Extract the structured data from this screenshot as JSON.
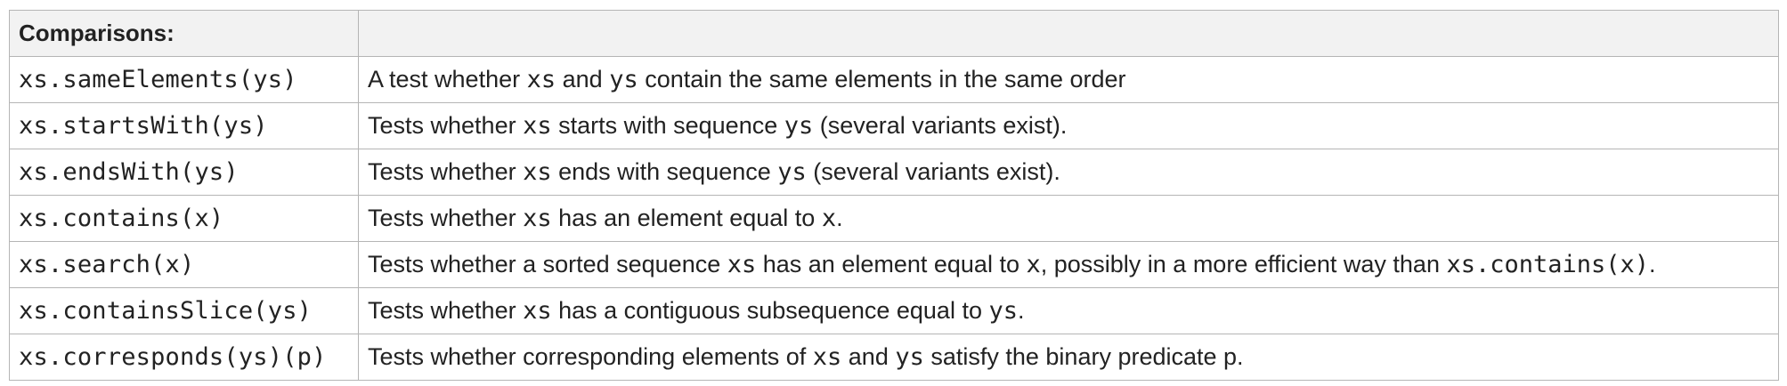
{
  "table": {
    "header": "Comparisons:",
    "rows": [
      {
        "op": "xs.sameElements(ys)",
        "desc": [
          {
            "t": "A test whether "
          },
          {
            "c": "xs"
          },
          {
            "t": " and "
          },
          {
            "c": "ys"
          },
          {
            "t": " contain the same elements in the same order"
          }
        ]
      },
      {
        "op": "xs.startsWith(ys)",
        "desc": [
          {
            "t": "Tests whether "
          },
          {
            "c": "xs"
          },
          {
            "t": " starts with sequence "
          },
          {
            "c": "ys"
          },
          {
            "t": " (several variants exist)."
          }
        ]
      },
      {
        "op": "xs.endsWith(ys)",
        "desc": [
          {
            "t": "Tests whether "
          },
          {
            "c": "xs"
          },
          {
            "t": " ends with sequence "
          },
          {
            "c": "ys"
          },
          {
            "t": " (several variants exist)."
          }
        ]
      },
      {
        "op": "xs.contains(x)",
        "desc": [
          {
            "t": "Tests whether "
          },
          {
            "c": "xs"
          },
          {
            "t": " has an element equal to "
          },
          {
            "c": "x"
          },
          {
            "t": "."
          }
        ]
      },
      {
        "op": "xs.search(x)",
        "desc": [
          {
            "t": "Tests whether a sorted sequence "
          },
          {
            "c": "xs"
          },
          {
            "t": " has an element equal to "
          },
          {
            "c": "x"
          },
          {
            "t": ", possibly in a more efficient way than "
          },
          {
            "c": "xs.contains(x)"
          },
          {
            "t": "."
          }
        ]
      },
      {
        "op": "xs.containsSlice(ys)",
        "desc": [
          {
            "t": "Tests whether "
          },
          {
            "c": "xs"
          },
          {
            "t": " has a contiguous subsequence equal to "
          },
          {
            "c": "ys"
          },
          {
            "t": "."
          }
        ]
      },
      {
        "op": "xs.corresponds(ys)(p)",
        "desc": [
          {
            "t": "Tests whether corresponding elements of "
          },
          {
            "c": "xs"
          },
          {
            "t": " and "
          },
          {
            "c": "ys"
          },
          {
            "t": " satisfy the binary predicate "
          },
          {
            "t": "p."
          }
        ]
      }
    ]
  }
}
